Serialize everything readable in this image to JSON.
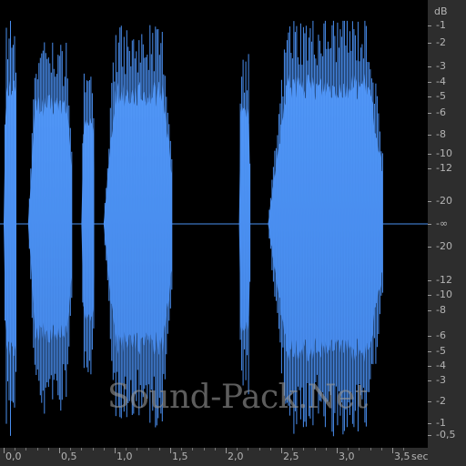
{
  "db_ruler": {
    "unit": "dB",
    "labels": [
      "-1",
      "-2",
      "-3",
      "-4",
      "-5",
      "-6",
      "-8",
      "-10",
      "-12",
      "-20",
      "-∞",
      "-20",
      "-12",
      "-10",
      "-8",
      "-6",
      "-5",
      "-4",
      "-3",
      "-2",
      "-1",
      "-0,5"
    ]
  },
  "time_ruler": {
    "unit": "sec",
    "labels": [
      "0,0",
      "0,5",
      "1,0",
      "1,5",
      "2,0",
      "2,5",
      "3,0",
      "3,5"
    ]
  },
  "watermark": "Sound-Pack.Net",
  "colors": {
    "waveform": "#4a8ff0",
    "waveform_dark": "#3d7cd8",
    "background": "#000000",
    "ruler": "#2d2d2d"
  },
  "waveform": {
    "duration_sec": 3.9,
    "segments": [
      {
        "start": 0.0,
        "end": 0.12,
        "level": 0.72
      },
      {
        "start": 0.22,
        "end": 0.62,
        "level": 0.62
      },
      {
        "start": 0.7,
        "end": 0.82,
        "level": 0.52
      },
      {
        "start": 0.9,
        "end": 1.52,
        "level": 0.68
      },
      {
        "start": 2.12,
        "end": 2.22,
        "level": 0.58
      },
      {
        "start": 2.38,
        "end": 3.42,
        "level": 0.72
      }
    ]
  }
}
